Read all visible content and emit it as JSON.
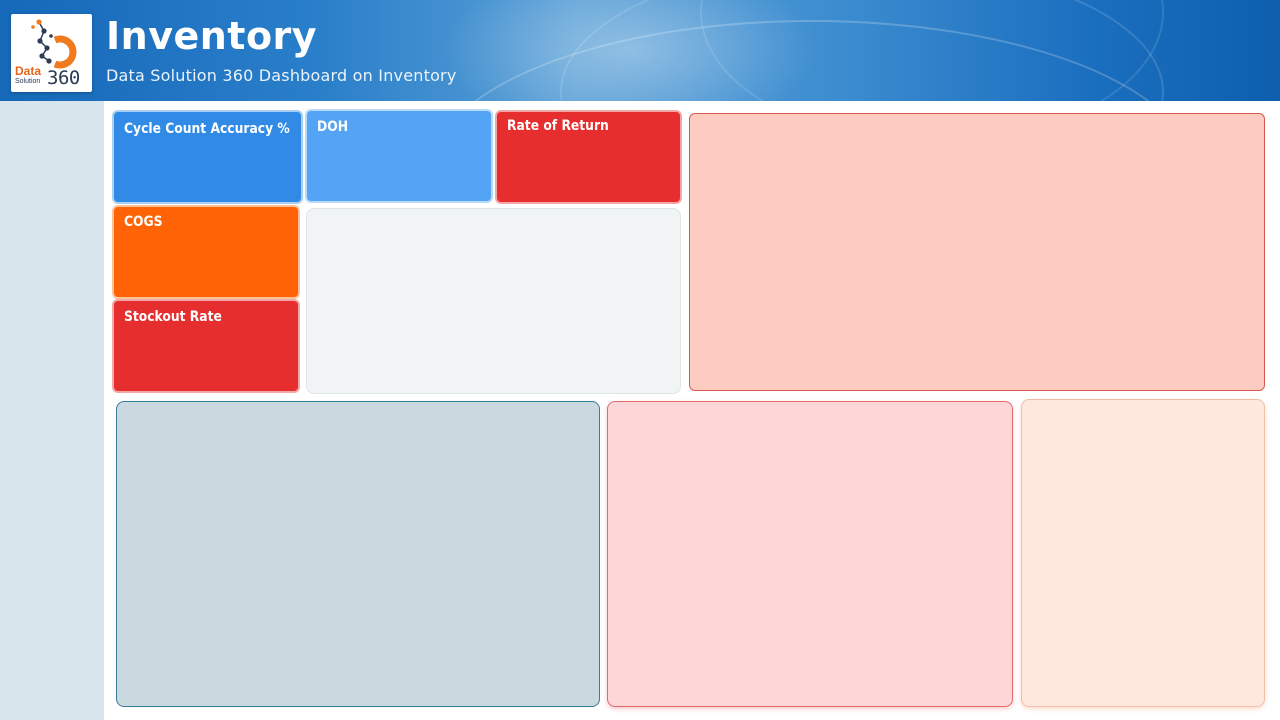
{
  "header": {
    "title": "Inventory",
    "subtitle": "Data Solution 360 Dashboard on Inventory",
    "logo": {
      "icon": "data-solution-360-logo",
      "text_data": "Data",
      "text_solution": "Solution",
      "text_360": "360"
    }
  },
  "kpis": {
    "cycle_count_accuracy": {
      "label": "Cycle Count Accuracy %",
      "color": "#318be6"
    },
    "doh": {
      "label": "DOH",
      "color": "#53a4f5"
    },
    "rate_of_return": {
      "label": "Rate of Return",
      "color": "#e72e2f"
    },
    "cogs": {
      "label": "COGS",
      "color": "#ff6305"
    },
    "stockout_rate": {
      "label": "Stockout Rate",
      "color": "#e72e2f"
    }
  },
  "panels": {
    "grey": {
      "color": "#f0f4f4"
    },
    "salmon": {
      "color": "#fecbc3"
    },
    "slate": {
      "color": "#cad9e0"
    },
    "pink": {
      "color": "#fdd6d8"
    },
    "peach": {
      "color": "#fee8de"
    }
  },
  "sidebar": {
    "color": "#d9e5ec"
  }
}
